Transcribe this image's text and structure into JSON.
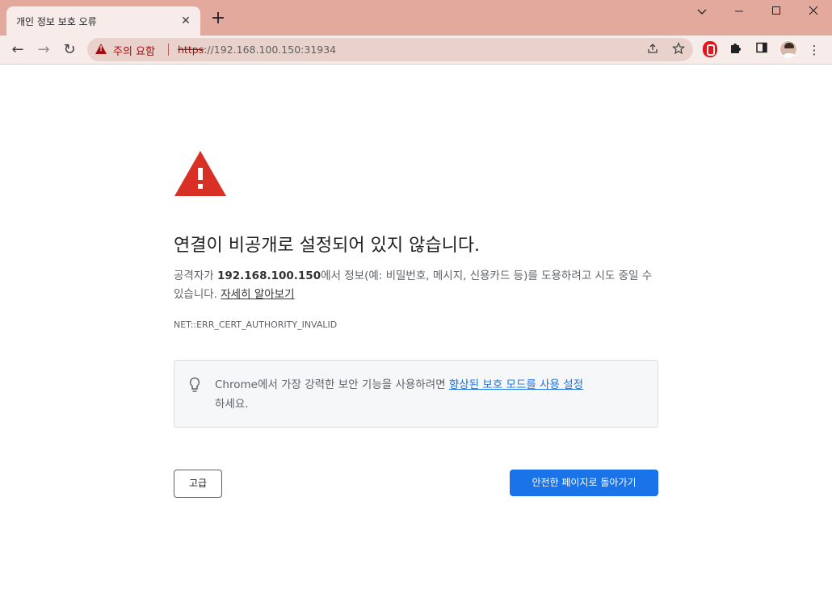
{
  "tab": {
    "title": "개인 정보 보호 오류",
    "close": "✕"
  },
  "newtab": "+",
  "window": {
    "minimize": "—",
    "maximize": "☐",
    "close": "✕",
    "tabsearch": "⌄"
  },
  "nav": {
    "back": "←",
    "forward": "→",
    "reload": "↻"
  },
  "omnibox": {
    "warning_label": "주의 요함",
    "url_scheme": "https",
    "url_rest": "://192.168.100.150:31934",
    "share_icon": "share-icon",
    "bookmark_icon": "star-icon"
  },
  "toolbar_icons": {
    "extensions": "puzzle-icon",
    "sidepanel": "side-panel-icon",
    "menu": "⋮"
  },
  "page": {
    "heading": "연결이 비공개로 설정되어 있지 않습니다.",
    "desc_prefix": "공격자가 ",
    "desc_host": "192.168.100.150",
    "desc_middle": "에서 정보(예: 비밀번호, 메시지, 신용카드 등)를 도용하려고 시도 중일 수 있습니다. ",
    "desc_link": "자세히 알아보기",
    "error_code": "NET::ERR_CERT_AUTHORITY_INVALID",
    "tip_prefix": "Chrome에서 가장 강력한 보안 기능을 사용하려면 ",
    "tip_link": "향상된 보호 모드를 사용 설정",
    "tip_suffix": "하세요.",
    "advanced_button": "고급",
    "back_button": "안전한 페이지로 돌아가기"
  },
  "colors": {
    "titlebar": "#e2a99c",
    "toolbar": "#f7ece9",
    "danger": "#a50e0e",
    "warning_icon": "#d93025",
    "primary": "#1a73e8"
  }
}
